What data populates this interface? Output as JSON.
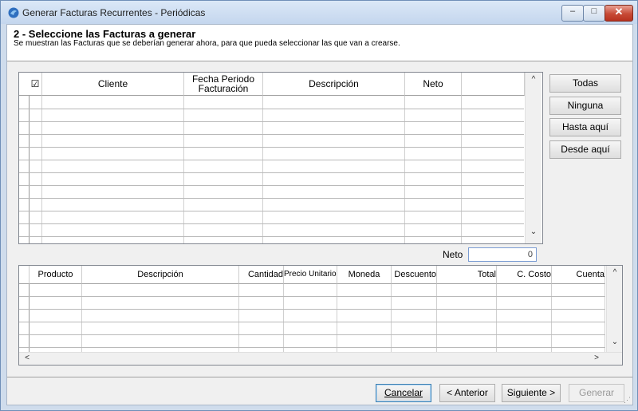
{
  "window": {
    "title": "Generar Facturas Recurrentes - Periódicas",
    "min_glyph": "–",
    "max_glyph": "□",
    "close_glyph": "✕"
  },
  "step": {
    "title": "2 - Seleccione las Facturas a generar",
    "subtitle": "Se muestran las Facturas que se deberían generar ahora, para que pueda seleccionar las que van a crearse."
  },
  "invoices_grid": {
    "check_header": "☑",
    "columns": [
      "Cliente",
      "Fecha Periodo Facturación",
      "Descripción",
      "Neto"
    ],
    "rows": []
  },
  "selection_buttons": {
    "all": "Todas",
    "none": "Ninguna",
    "up_to_here": "Hasta aquí",
    "from_here": "Desde aquí"
  },
  "total": {
    "label": "Neto",
    "value": "0"
  },
  "details_grid": {
    "columns": [
      "Producto",
      "Descripción",
      "Cantidad",
      "Precio Unitario (",
      "Moneda",
      "Descuento",
      "Total",
      "C. Costo",
      "Cuenta"
    ],
    "rows": []
  },
  "scroll_glyphs": {
    "up": "^",
    "down": "⌄",
    "left": "<",
    "right": ">"
  },
  "wizard": {
    "cancel": "Cancelar",
    "previous": "< Anterior",
    "next": "Siguiente >",
    "generate": "Generar"
  },
  "colors": {
    "titlebar": "#c4d6ee",
    "close": "#c74a36",
    "focus_border": "#3c7fb1"
  }
}
